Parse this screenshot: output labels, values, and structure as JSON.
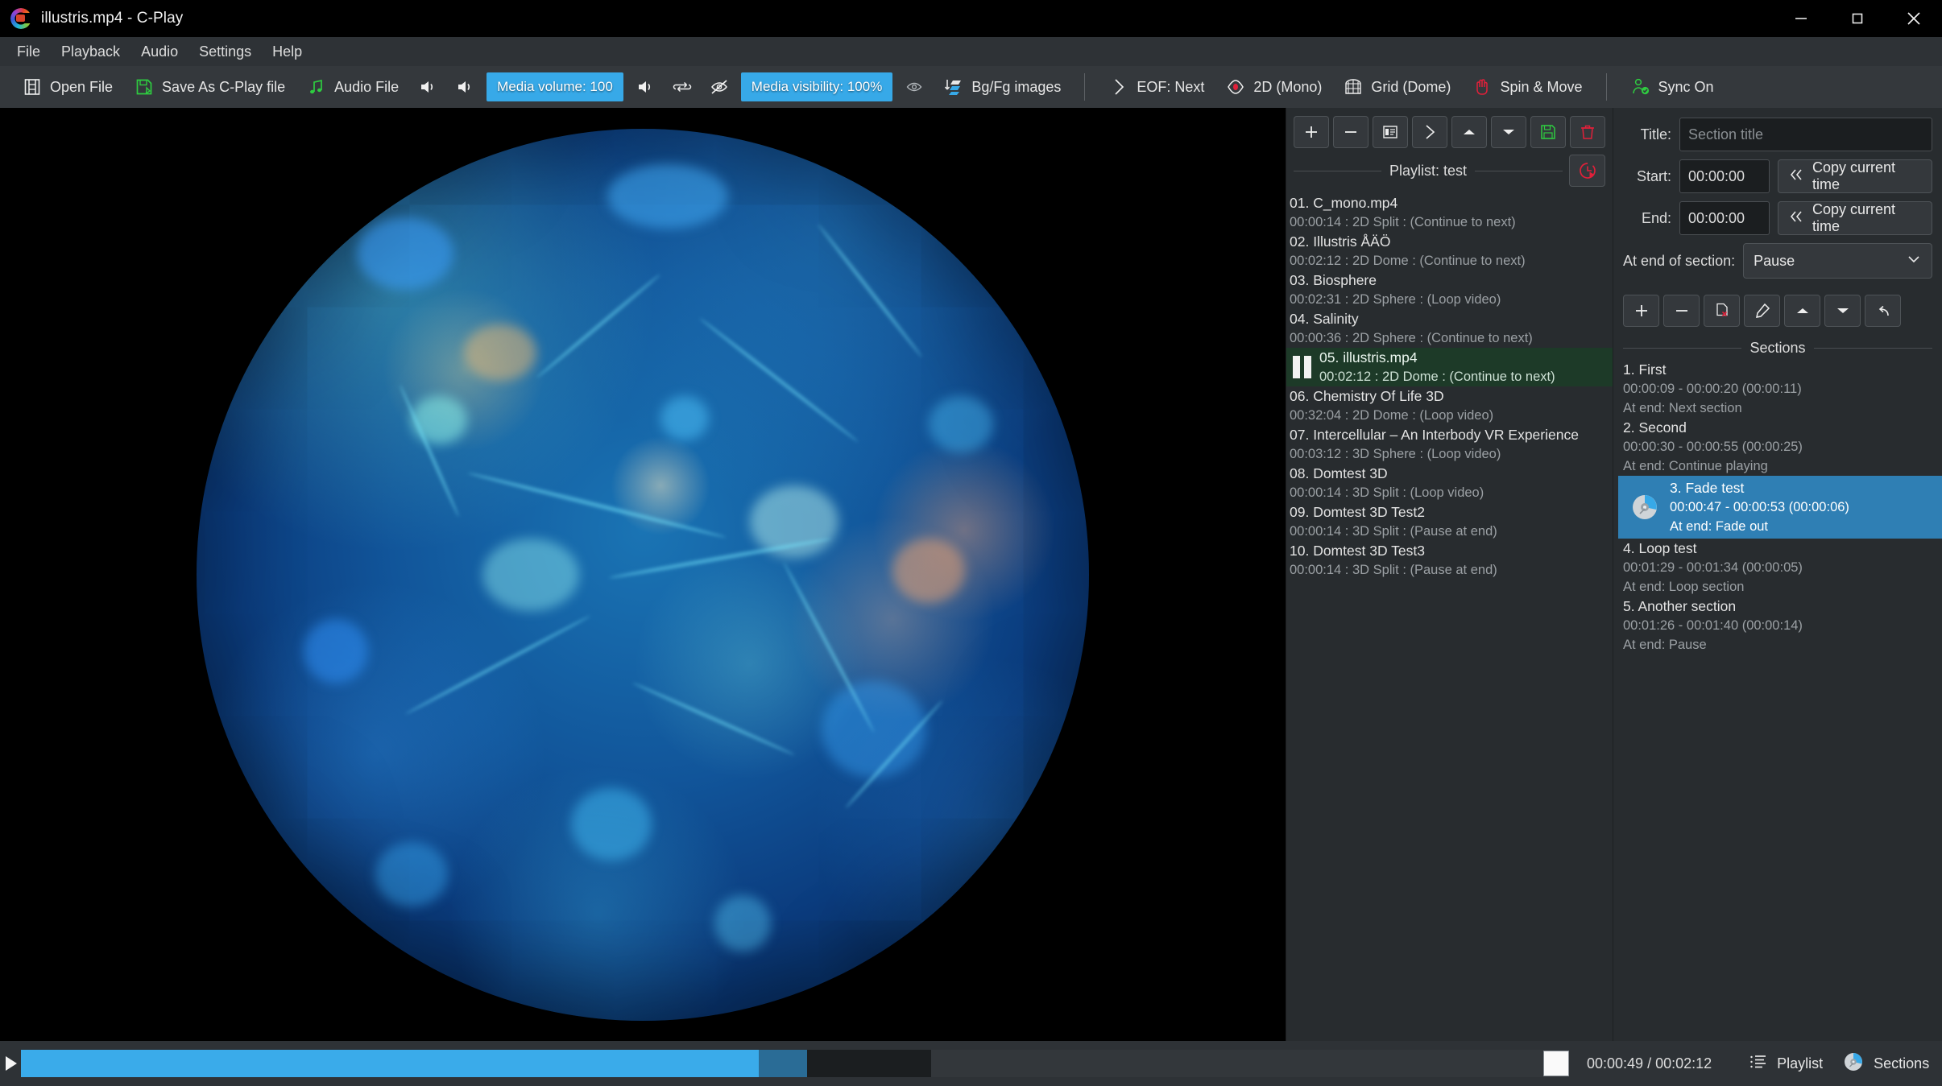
{
  "window": {
    "title": "illustris.mp4 - C-Play",
    "minimize_label": "—",
    "maximize_label": "□",
    "close_label": "✕"
  },
  "menubar": {
    "items": [
      {
        "label": "File"
      },
      {
        "label": "Playback"
      },
      {
        "label": "Audio"
      },
      {
        "label": "Settings"
      },
      {
        "label": "Help"
      }
    ]
  },
  "toolbar": {
    "open_file": "Open File",
    "save_as": "Save As C-Play file",
    "audio_file": "Audio File",
    "media_volume": "Media volume: 100",
    "media_visibility": "Media visibility: 100%",
    "bg_fg_images": "Bg/Fg images",
    "eof": "EOF: Next",
    "stereo_mode": "2D (Mono)",
    "grid_mode": "Grid (Dome)",
    "spin_move": "Spin & Move",
    "sync": "Sync On"
  },
  "playlist": {
    "title": "Playlist: test",
    "tool_add": "+",
    "tool_remove": "−",
    "items": [
      {
        "name": "01. C_mono.mp4",
        "detail": "00:00:14 : 2D Split : (Continue to next)",
        "selected": false
      },
      {
        "name": "02. Illustris ÅÄÖ",
        "detail": "00:02:12 : 2D Dome : (Continue to next)",
        "selected": false
      },
      {
        "name": "03. Biosphere",
        "detail": "00:02:31 : 2D Sphere : (Loop video)",
        "selected": false
      },
      {
        "name": "04. Salinity",
        "detail": "00:00:36 : 2D Sphere : (Continue to next)",
        "selected": false
      },
      {
        "name": "05. illustris.mp4",
        "detail": "00:02:12 : 2D Dome : (Continue to next)",
        "selected": true
      },
      {
        "name": "06. Chemistry Of Life 3D",
        "detail": "00:32:04 : 2D Dome : (Loop video)",
        "selected": false
      },
      {
        "name": "07. Intercellular – An Interbody VR Experience",
        "detail": "00:03:12 : 3D Sphere : (Loop video)",
        "selected": false
      },
      {
        "name": "08. Domtest 3D",
        "detail": "00:00:14 : 3D Split : (Loop video)",
        "selected": false
      },
      {
        "name": "09. Domtest 3D Test2",
        "detail": "00:00:14 : 3D Split : (Pause at end)",
        "selected": false
      },
      {
        "name": "10. Domtest 3D Test3",
        "detail": "00:00:14 : 3D Split : (Pause at end)",
        "selected": false
      }
    ]
  },
  "sections_editor": {
    "title_label": "Title:",
    "title_placeholder": "Section title",
    "title_value": "",
    "start_label": "Start:",
    "start_value": "00:00:00",
    "end_label": "End:",
    "end_value": "00:00:00",
    "copy_start_label": "Copy current time",
    "copy_end_label": "Copy current time",
    "at_end_label": "At end of section:",
    "at_end_value": "Pause"
  },
  "sections": {
    "header": "Sections",
    "items": [
      {
        "name": "1. First",
        "time": "00:00:09 - 00:00:20 (00:00:11)",
        "at_end": "At end: Next section",
        "selected": false
      },
      {
        "name": "2. Second",
        "time": "00:00:30 - 00:00:55 (00:00:25)",
        "at_end": "At end: Continue playing",
        "selected": false
      },
      {
        "name": "3. Fade test",
        "time": "00:00:47 - 00:00:53 (00:00:06)",
        "at_end": "At end: Fade out",
        "selected": true
      },
      {
        "name": "4. Loop test",
        "time": "00:01:29 - 00:01:34 (00:00:05)",
        "at_end": "At end: Loop section",
        "selected": false
      },
      {
        "name": "5. Another section",
        "time": "00:01:26 - 00:01:40 (00:00:14)",
        "at_end": "At end: Pause",
        "selected": false
      }
    ]
  },
  "bottom": {
    "time": "00:00:49 / 00:02:12",
    "playlist_label": "Playlist",
    "sections_label": "Sections",
    "progress_percent": 38,
    "buffer_percent": 40.5
  },
  "colors": {
    "accent": "#37a9e8",
    "selection_green": "#1d3a28",
    "selection_blue": "#2f7fb4",
    "toolbar_bg": "#34383c",
    "panel_bg": "#282c2f",
    "window_bg": "#2e3236",
    "green_icon": "#2ecc40",
    "red_icon": "#e0203a"
  }
}
